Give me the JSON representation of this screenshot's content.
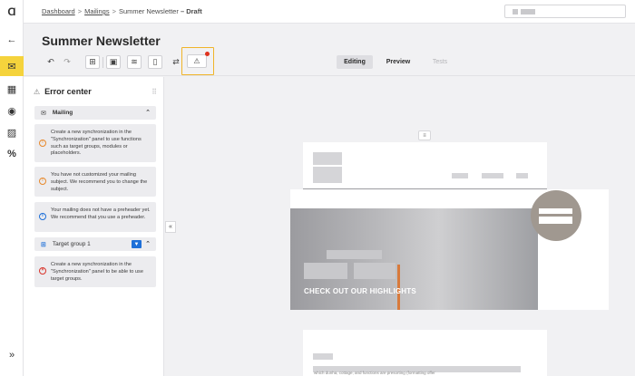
{
  "breadcrumb": {
    "items": [
      "Dashboard",
      "Mailings",
      "Summer Newsletter",
      "Draft"
    ],
    "separator": ">",
    "status_sep": "–"
  },
  "page": {
    "title": "Summer Newsletter"
  },
  "toolbar": {
    "tools": [
      "undo-icon",
      "redo-icon",
      "add-block-icon",
      "image-icon",
      "layers-icon",
      "mobile-icon",
      "link-icon",
      "warning-icon"
    ],
    "undo_glyph": "↶",
    "redo_glyph": "↷",
    "add_glyph": "⊞",
    "image_glyph": "▣",
    "layers_glyph": "≋",
    "mobile_glyph": "▯",
    "link_glyph": "⇄",
    "warning_glyph": "⚠",
    "warning_indicator_color": "#e0321d",
    "highlight_color": "#f0b429"
  },
  "view_modes": {
    "editing": "Editing",
    "preview": "Preview",
    "tests": "Tests",
    "active": "Editing"
  },
  "rail": {
    "logo_glyph": "Ɑ",
    "back_glyph": "←",
    "mail_glyph": "✉",
    "grid_glyph": "▦",
    "eye_glyph": "◉",
    "picture_glyph": "▨",
    "percent_glyph": "%",
    "expand_glyph": "»",
    "accent": "#f5d33c"
  },
  "error_center": {
    "title": "Error center",
    "title_glyph": "⚠",
    "drag_glyph": "⠿",
    "collapse_glyph": "«",
    "sections": [
      {
        "label": "Mailing",
        "icon": "mail-icon",
        "glyph": "✉",
        "chevron": "⌃"
      },
      {
        "label": "Target group 1",
        "icon": "target-group-icon",
        "glyph": "⊞",
        "badge": "▼",
        "chevron": "⌃"
      }
    ],
    "messages": [
      {
        "severity": "warning",
        "glyph": "!",
        "text": "Create a new synchronization in the \"Synchronization\" panel to use functions such as target groups, modules or placeholders."
      },
      {
        "severity": "warning",
        "glyph": "!",
        "text": "You have not customized your mailing subject. We recommend you to change the subject."
      },
      {
        "severity": "info",
        "glyph": "i",
        "text": "Your mailing does not have a preheader yet. We recommend that you use a preheader."
      },
      {
        "severity": "error",
        "glyph": "×",
        "text": "Create a new synchronization in the \"Synchronization\" panel to be able to use target groups."
      }
    ]
  },
  "canvas": {
    "handle_glyph": "≡",
    "hero_text": "CHECK OUT OUR HIGHLIGHTS",
    "footer_snippet": "which dunha, cottage, and functions are presorting (formatting offer"
  }
}
